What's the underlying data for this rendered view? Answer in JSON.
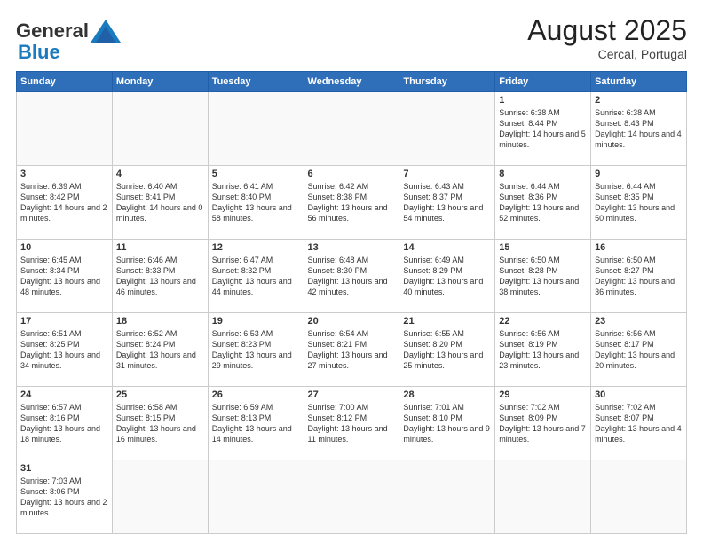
{
  "header": {
    "logo_general": "General",
    "logo_blue": "Blue",
    "month_year": "August 2025",
    "location": "Cercal, Portugal"
  },
  "days_of_week": [
    "Sunday",
    "Monday",
    "Tuesday",
    "Wednesday",
    "Thursday",
    "Friday",
    "Saturday"
  ],
  "weeks": [
    [
      {
        "day": "",
        "info": ""
      },
      {
        "day": "",
        "info": ""
      },
      {
        "day": "",
        "info": ""
      },
      {
        "day": "",
        "info": ""
      },
      {
        "day": "",
        "info": ""
      },
      {
        "day": "1",
        "info": "Sunrise: 6:38 AM\nSunset: 8:44 PM\nDaylight: 14 hours and 5 minutes."
      },
      {
        "day": "2",
        "info": "Sunrise: 6:38 AM\nSunset: 8:43 PM\nDaylight: 14 hours and 4 minutes."
      }
    ],
    [
      {
        "day": "3",
        "info": "Sunrise: 6:39 AM\nSunset: 8:42 PM\nDaylight: 14 hours and 2 minutes."
      },
      {
        "day": "4",
        "info": "Sunrise: 6:40 AM\nSunset: 8:41 PM\nDaylight: 14 hours and 0 minutes."
      },
      {
        "day": "5",
        "info": "Sunrise: 6:41 AM\nSunset: 8:40 PM\nDaylight: 13 hours and 58 minutes."
      },
      {
        "day": "6",
        "info": "Sunrise: 6:42 AM\nSunset: 8:38 PM\nDaylight: 13 hours and 56 minutes."
      },
      {
        "day": "7",
        "info": "Sunrise: 6:43 AM\nSunset: 8:37 PM\nDaylight: 13 hours and 54 minutes."
      },
      {
        "day": "8",
        "info": "Sunrise: 6:44 AM\nSunset: 8:36 PM\nDaylight: 13 hours and 52 minutes."
      },
      {
        "day": "9",
        "info": "Sunrise: 6:44 AM\nSunset: 8:35 PM\nDaylight: 13 hours and 50 minutes."
      }
    ],
    [
      {
        "day": "10",
        "info": "Sunrise: 6:45 AM\nSunset: 8:34 PM\nDaylight: 13 hours and 48 minutes."
      },
      {
        "day": "11",
        "info": "Sunrise: 6:46 AM\nSunset: 8:33 PM\nDaylight: 13 hours and 46 minutes."
      },
      {
        "day": "12",
        "info": "Sunrise: 6:47 AM\nSunset: 8:32 PM\nDaylight: 13 hours and 44 minutes."
      },
      {
        "day": "13",
        "info": "Sunrise: 6:48 AM\nSunset: 8:30 PM\nDaylight: 13 hours and 42 minutes."
      },
      {
        "day": "14",
        "info": "Sunrise: 6:49 AM\nSunset: 8:29 PM\nDaylight: 13 hours and 40 minutes."
      },
      {
        "day": "15",
        "info": "Sunrise: 6:50 AM\nSunset: 8:28 PM\nDaylight: 13 hours and 38 minutes."
      },
      {
        "day": "16",
        "info": "Sunrise: 6:50 AM\nSunset: 8:27 PM\nDaylight: 13 hours and 36 minutes."
      }
    ],
    [
      {
        "day": "17",
        "info": "Sunrise: 6:51 AM\nSunset: 8:25 PM\nDaylight: 13 hours and 34 minutes."
      },
      {
        "day": "18",
        "info": "Sunrise: 6:52 AM\nSunset: 8:24 PM\nDaylight: 13 hours and 31 minutes."
      },
      {
        "day": "19",
        "info": "Sunrise: 6:53 AM\nSunset: 8:23 PM\nDaylight: 13 hours and 29 minutes."
      },
      {
        "day": "20",
        "info": "Sunrise: 6:54 AM\nSunset: 8:21 PM\nDaylight: 13 hours and 27 minutes."
      },
      {
        "day": "21",
        "info": "Sunrise: 6:55 AM\nSunset: 8:20 PM\nDaylight: 13 hours and 25 minutes."
      },
      {
        "day": "22",
        "info": "Sunrise: 6:56 AM\nSunset: 8:19 PM\nDaylight: 13 hours and 23 minutes."
      },
      {
        "day": "23",
        "info": "Sunrise: 6:56 AM\nSunset: 8:17 PM\nDaylight: 13 hours and 20 minutes."
      }
    ],
    [
      {
        "day": "24",
        "info": "Sunrise: 6:57 AM\nSunset: 8:16 PM\nDaylight: 13 hours and 18 minutes."
      },
      {
        "day": "25",
        "info": "Sunrise: 6:58 AM\nSunset: 8:15 PM\nDaylight: 13 hours and 16 minutes."
      },
      {
        "day": "26",
        "info": "Sunrise: 6:59 AM\nSunset: 8:13 PM\nDaylight: 13 hours and 14 minutes."
      },
      {
        "day": "27",
        "info": "Sunrise: 7:00 AM\nSunset: 8:12 PM\nDaylight: 13 hours and 11 minutes."
      },
      {
        "day": "28",
        "info": "Sunrise: 7:01 AM\nSunset: 8:10 PM\nDaylight: 13 hours and 9 minutes."
      },
      {
        "day": "29",
        "info": "Sunrise: 7:02 AM\nSunset: 8:09 PM\nDaylight: 13 hours and 7 minutes."
      },
      {
        "day": "30",
        "info": "Sunrise: 7:02 AM\nSunset: 8:07 PM\nDaylight: 13 hours and 4 minutes."
      }
    ],
    [
      {
        "day": "31",
        "info": "Sunrise: 7:03 AM\nSunset: 8:06 PM\nDaylight: 13 hours and 2 minutes."
      },
      {
        "day": "",
        "info": ""
      },
      {
        "day": "",
        "info": ""
      },
      {
        "day": "",
        "info": ""
      },
      {
        "day": "",
        "info": ""
      },
      {
        "day": "",
        "info": ""
      },
      {
        "day": "",
        "info": ""
      }
    ]
  ]
}
